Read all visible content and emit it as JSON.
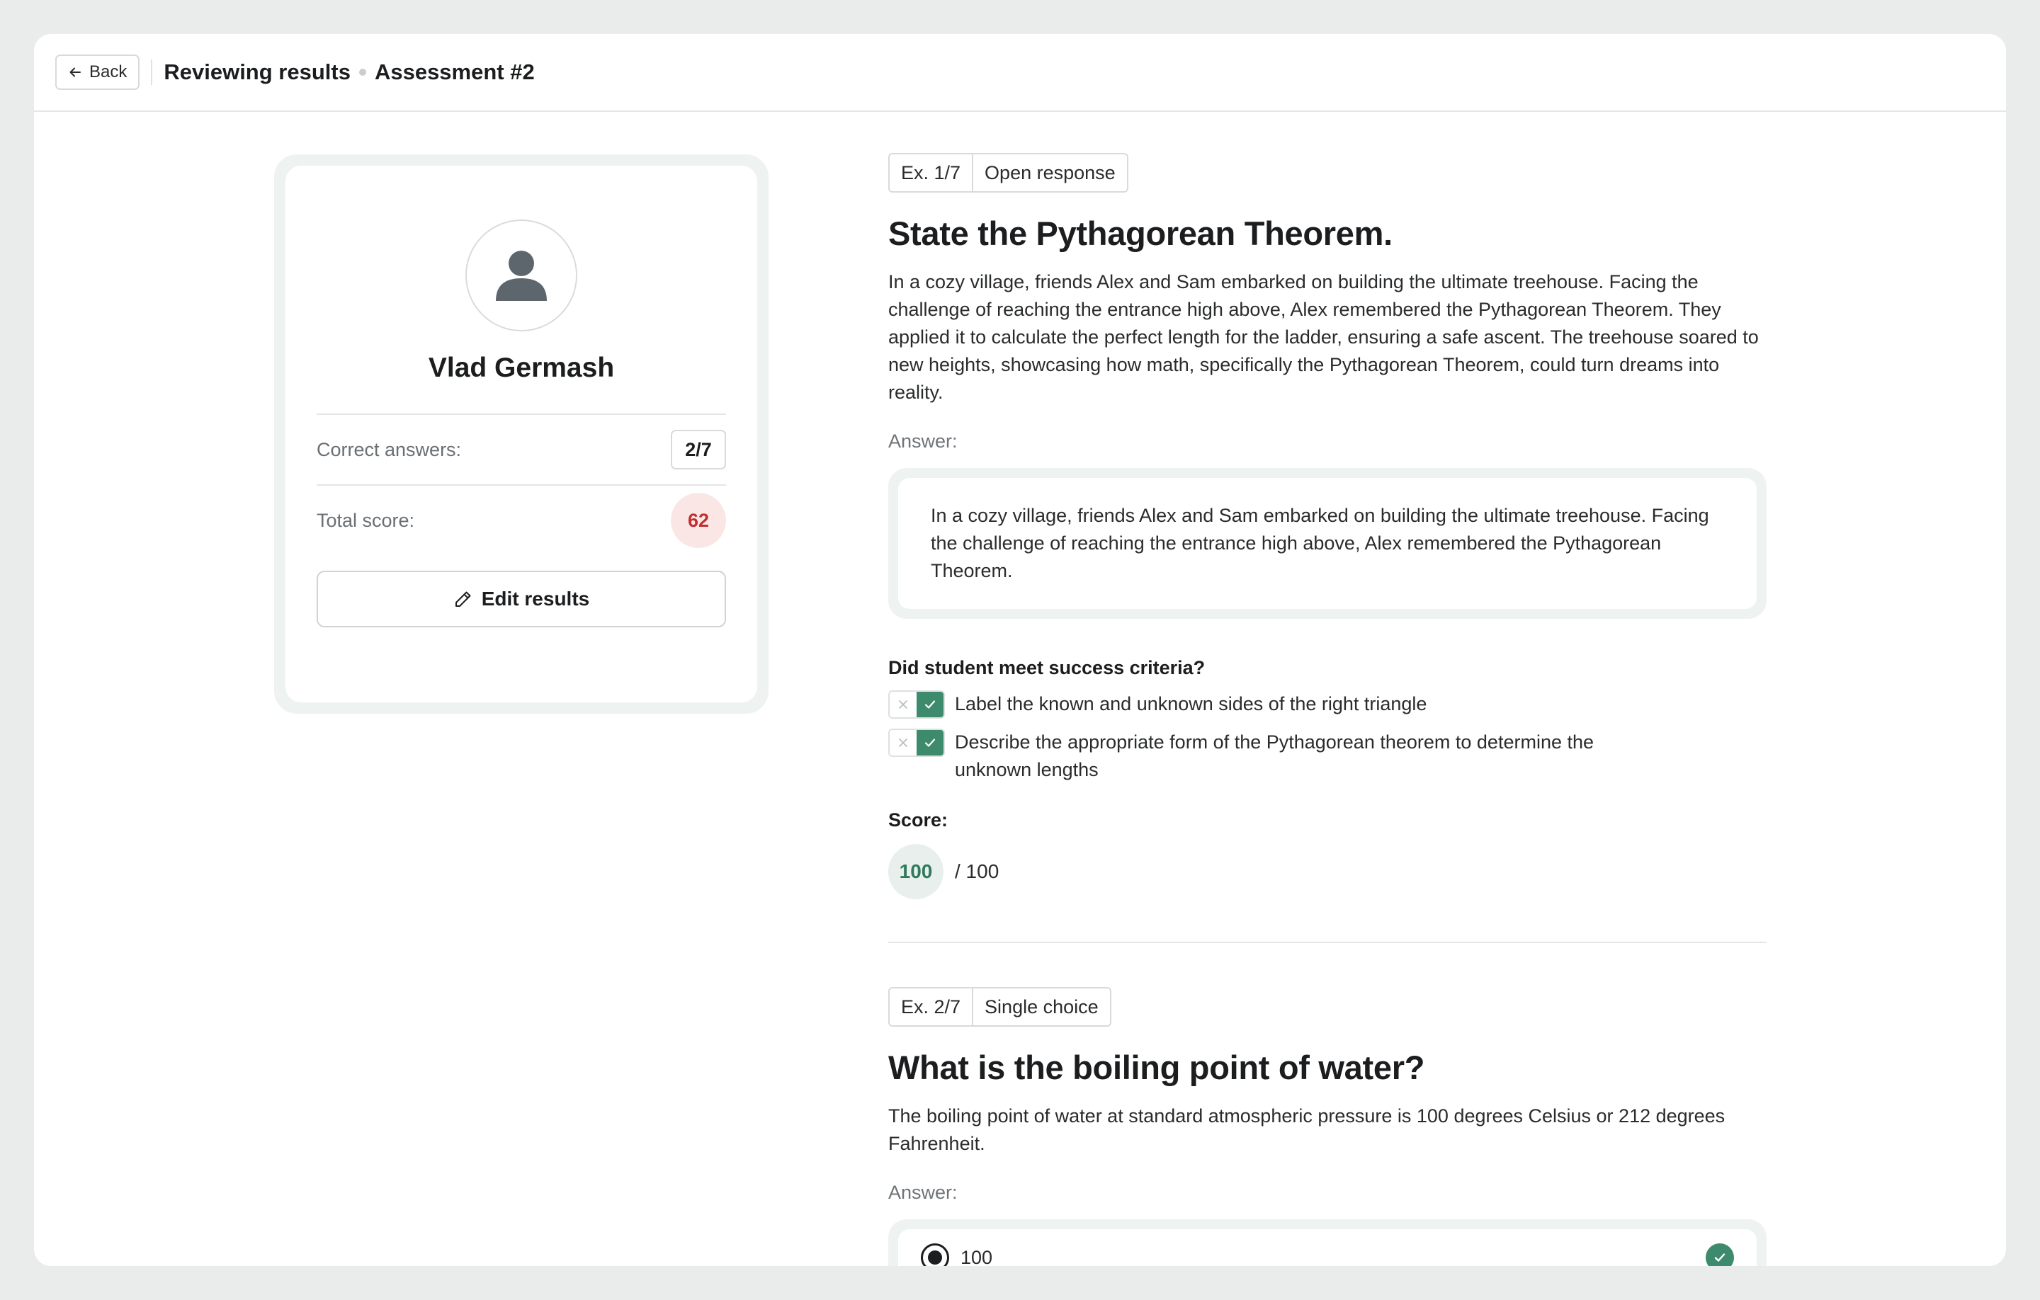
{
  "header": {
    "back_label": "Back",
    "title": "Reviewing results",
    "subtitle": "Assessment #2"
  },
  "profile": {
    "name": "Vlad Germash",
    "correct_label": "Correct answers:",
    "correct_value": "2/7",
    "score_label": "Total score:",
    "score_value": "62",
    "edit_label": "Edit results"
  },
  "exercises": [
    {
      "number": "Ex. 1/7",
      "type": "Open response",
      "title": "State the Pythagorean Theorem.",
      "description": "In a cozy village, friends Alex and Sam embarked on building the ultimate treehouse. Facing the challenge of reaching the entrance high above, Alex remembered the Pythagorean Theorem. They applied it to calculate the perfect length for the ladder, ensuring a safe ascent. The treehouse soared to new heights, showcasing how math, specifically the Pythagorean Theorem, could turn dreams into reality.",
      "answer_label": "Answer:",
      "answer": "In a cozy village, friends Alex and Sam embarked on building the ultimate treehouse. Facing the challenge of reaching the entrance high above, Alex remembered the Pythagorean Theorem.",
      "criteria_title": "Did student meet success criteria?",
      "criteria": [
        {
          "text": "Label the known and unknown sides of the right triangle",
          "met": true
        },
        {
          "text": "Describe the appropriate form of the Pythagorean theorem to determine the unknown lengths",
          "met": true
        }
      ],
      "score_label": "Score:",
      "score": "100",
      "score_max": "/ 100"
    },
    {
      "number": "Ex. 2/7",
      "type": "Single choice",
      "title": "What is the boiling point of water?",
      "description": "The boiling point of water at standard atmospheric pressure is 100 degrees Celsius or 212 degrees Fahrenheit.",
      "answer_label": "Answer:",
      "selected_option": "100",
      "selected_correct": true
    }
  ],
  "colors": {
    "accent_green": "#3d8a6c",
    "score_red": "#c22f2f",
    "score_red_bg": "#fbe6e6",
    "panel_bg": "#eef2f1"
  }
}
